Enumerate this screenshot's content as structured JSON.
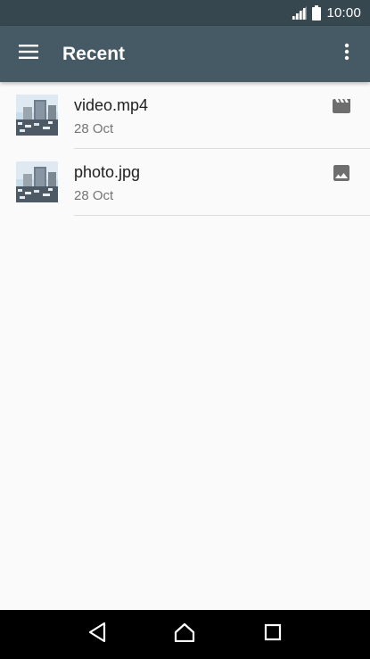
{
  "status_bar": {
    "time": "10:00",
    "signal_icon": "cell-signal-icon",
    "battery_icon": "battery-icon"
  },
  "toolbar": {
    "title": "Recent",
    "menu_icon": "hamburger-menu-icon",
    "overflow_icon": "more-vert-icon"
  },
  "files": [
    {
      "name": "video.mp4",
      "date": "28 Oct",
      "type_icon": "movie-icon"
    },
    {
      "name": "photo.jpg",
      "date": "28 Oct",
      "type_icon": "image-icon"
    }
  ],
  "nav_bar": {
    "back_icon": "back-icon",
    "home_icon": "home-icon",
    "recents_icon": "recent-apps-icon"
  },
  "colors": {
    "toolbar": "#455a64",
    "status_bar": "#37474f",
    "background": "#fafafa",
    "nav_bar": "#000000"
  }
}
